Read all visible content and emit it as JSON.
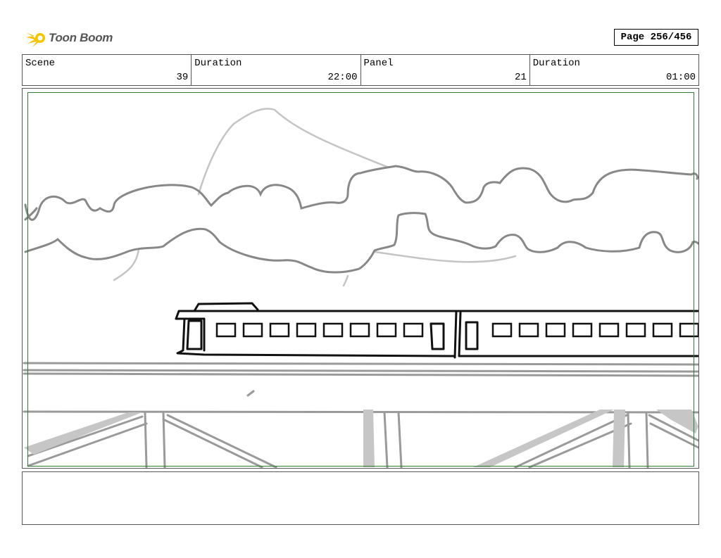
{
  "brand": {
    "name": "Toon Boom",
    "icon": "toon-boom-logo-icon",
    "accent": "#f5c400"
  },
  "page": {
    "label": "Page 256/456"
  },
  "info": {
    "scene_label": "Scene",
    "scene_value": "39",
    "scene_duration_label": "Duration",
    "scene_duration_value": "22:00",
    "panel_label": "Panel",
    "panel_value": "21",
    "panel_duration_label": "Duration",
    "panel_duration_value": "01:00"
  },
  "panel": {
    "safe_area_color": "#2e7d32",
    "sketch": [
      "clouds",
      "mountain",
      "train",
      "bridge"
    ]
  },
  "notes": {
    "text": ""
  }
}
